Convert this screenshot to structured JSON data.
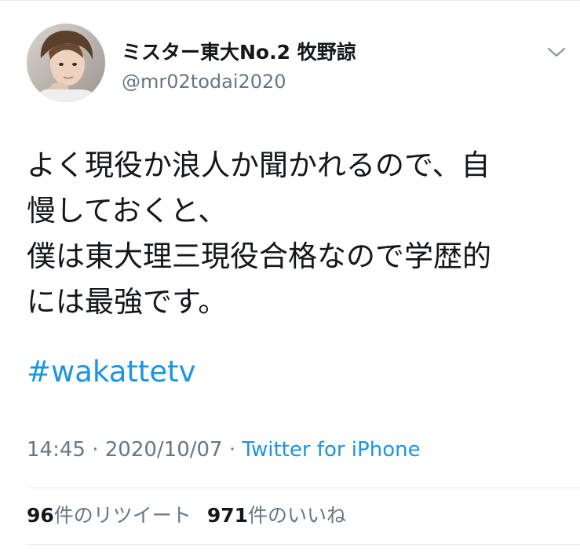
{
  "tweet": {
    "author": {
      "display_name": "ミスター東大No.2 牧野諒",
      "handle": "@mr02todai2020",
      "avatar_icon": "profile-photo"
    },
    "menu_icon": "chevron-down-icon",
    "text": "よく現役か浪人か聞かれるので、自\n慢しておくと、\n僕は東大理三現役合格なので学歴的\nには最強です。",
    "hashtag": "#wakattetv",
    "time": "14:45",
    "separator_1": " · ",
    "date": "2020/10/07",
    "separator_2": " · ",
    "source": "Twitter for iPhone",
    "retweets": {
      "count": "96",
      "label": "件のリツイート"
    },
    "likes": {
      "count": "971",
      "label": "件のいいね"
    }
  },
  "colors": {
    "text_primary": "#14171a",
    "text_secondary": "#657786",
    "link": "#1b95e0",
    "divider": "#e6ecf0",
    "background": "#ffffff"
  }
}
